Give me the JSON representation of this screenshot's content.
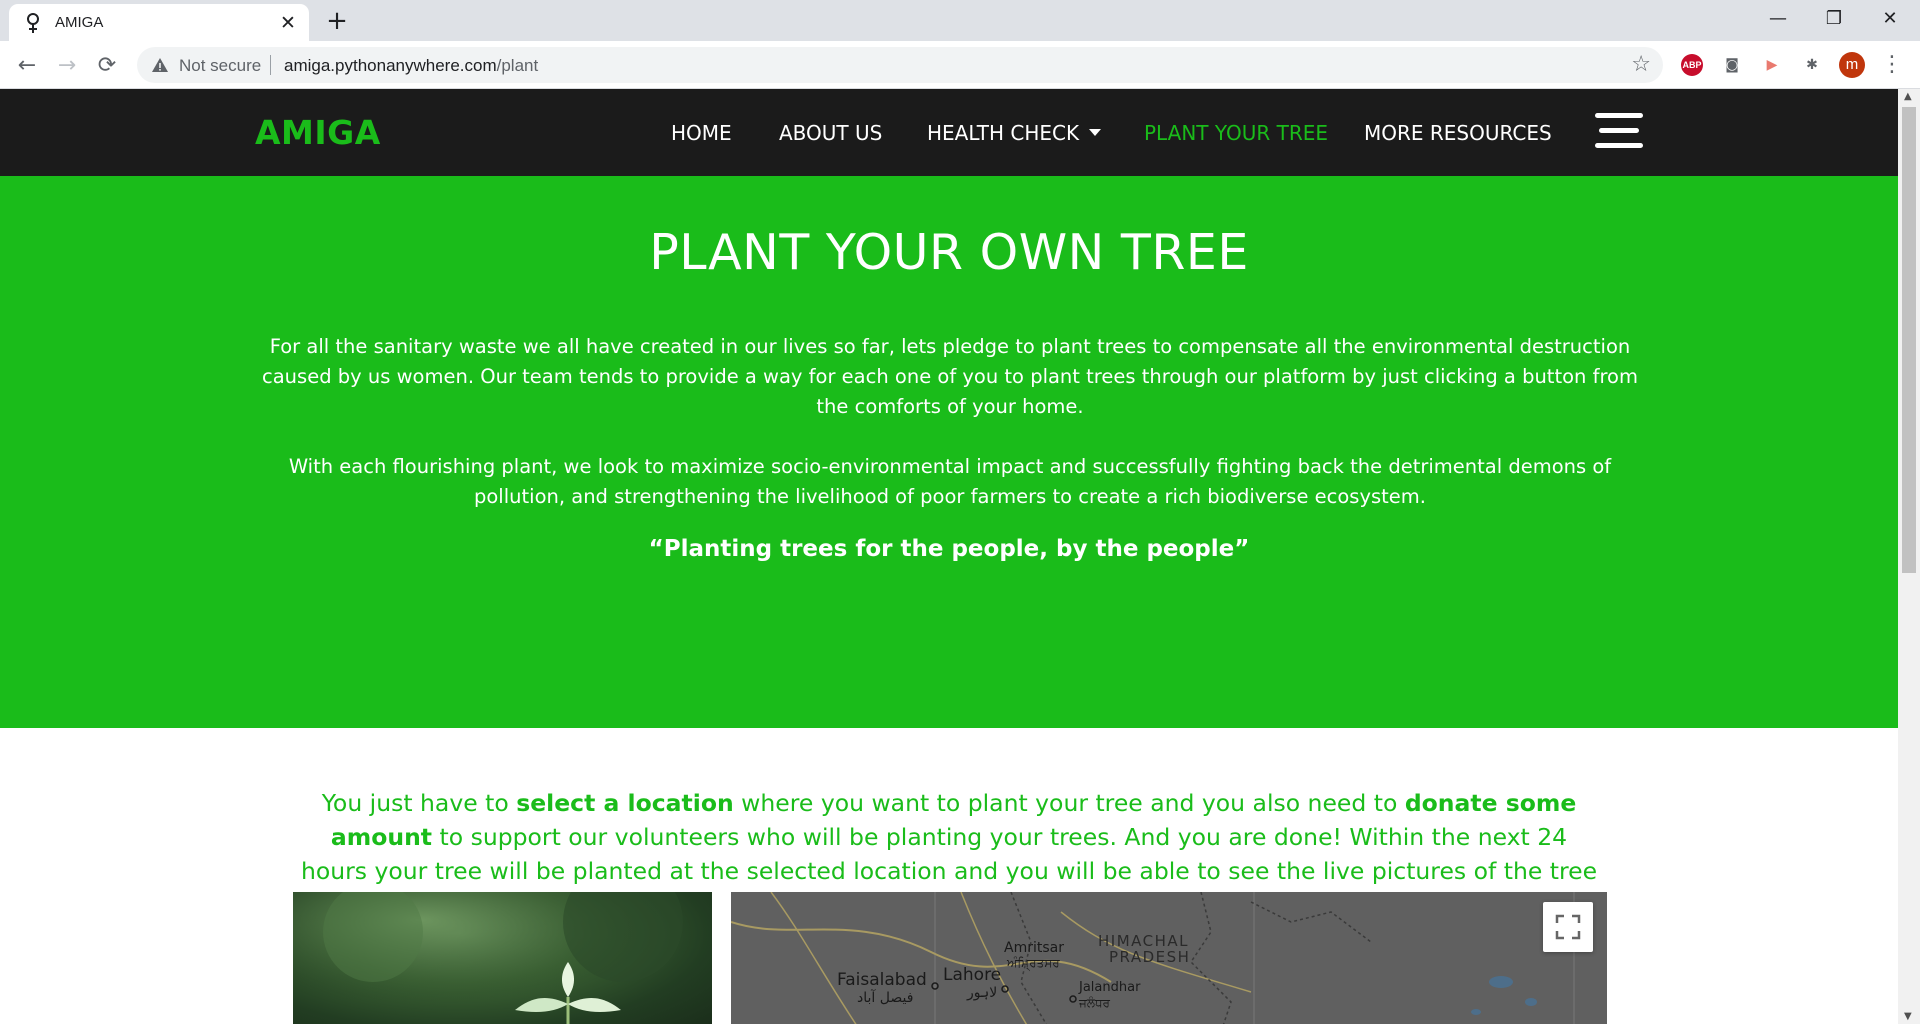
{
  "browser": {
    "tab_title": "AMIGA",
    "tab_close": "✕",
    "new_tab": "+",
    "window_controls": {
      "minimize": "—",
      "restore": "❐",
      "close": "✕"
    },
    "nav": {
      "back": "←",
      "forward": "→",
      "reload": "⟳"
    },
    "security_label": "Not secure",
    "url_host": "amiga.pythonanywhere.com",
    "url_path": "/plant",
    "bookmark_icon": "☆",
    "extensions": {
      "abp": "ABP",
      "camera": "◙",
      "cast": "▶",
      "puzzle": "✱",
      "avatar": "m",
      "menu": "⋮"
    }
  },
  "site": {
    "brand": "AMIGA",
    "nav": [
      {
        "label": "HOME"
      },
      {
        "label": "ABOUT US"
      },
      {
        "label": "HEALTH CHECK"
      },
      {
        "label": "PLANT YOUR TREE"
      },
      {
        "label": "MORE RESOURCES"
      }
    ],
    "active_nav": "PLANT YOUR TREE",
    "colors": {
      "accent": "#1abc1a",
      "nav_bg": "#1b1b1b"
    }
  },
  "hero": {
    "title": "PLANT YOUR OWN TREE",
    "paragraph1": "For all the sanitary waste we all have created in our lives so far, lets pledge to plant trees to compensate all the environmental destruction caused by us women. Our team tends to provide a way for each one of you to plant trees through our platform by just clicking a button from the comforts of your home.",
    "paragraph2": "With each flourishing plant, we look to maximize socio-environmental impact and successfully fighting back the detrimental demons of pollution, and strengthening the livelihood of poor farmers to create a rich biodiverse ecosystem.",
    "quote": "“Planting trees for the people, by the people”"
  },
  "intro": {
    "part1": "You just have to ",
    "bold1": "select a location",
    "part2": " where you want to plant your tree and you also need to ",
    "bold2": "donate some amount",
    "part3": " to support our volunteers who will be planting your trees. And you are done! Within the next 24 hours your tree will be planted at the selected location and you will be able to see the live pictures of the tree growing!"
  },
  "map": {
    "labels": {
      "amritsar": "Amritsar",
      "amritsar_local": "ਅੰਮ੍ਰਿਤਸਰ",
      "himachal": "HIMACHAL",
      "pradesh": "PRADESH",
      "faisalabad": "Faisalabad",
      "faisalabad_local": "فیصل آباد",
      "lahore": "Lahore",
      "lahore_local": "لاہور",
      "jalandhar": "Jalandhar",
      "jalandhar_local": "ਜਲੰਧਰ"
    }
  }
}
